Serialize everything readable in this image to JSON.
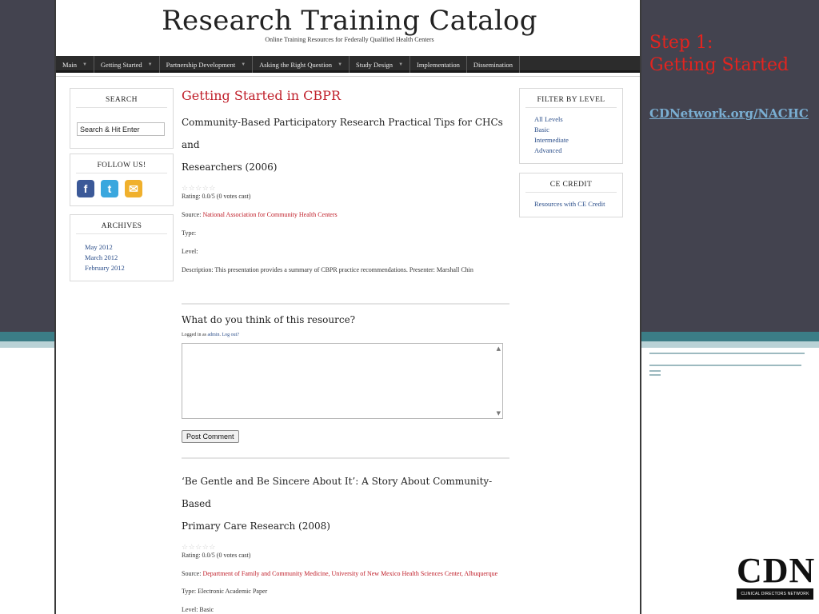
{
  "site": {
    "title": "Research Training Catalog",
    "subtitle": "Online Training Resources for Federally Qualified Health Centers"
  },
  "nav": [
    {
      "label": "Main",
      "dropdown": true
    },
    {
      "label": "Getting Started",
      "dropdown": true
    },
    {
      "label": "Partnership Development",
      "dropdown": true
    },
    {
      "label": "Asking the Right Question",
      "dropdown": true
    },
    {
      "label": "Study Design",
      "dropdown": true
    },
    {
      "label": "Implementation",
      "dropdown": false
    },
    {
      "label": "Dissemination",
      "dropdown": false
    }
  ],
  "sidebar": {
    "search": {
      "title": "SEARCH",
      "value": "Search & Hit Enter"
    },
    "follow": {
      "title": "FOLLOW US!",
      "icons": [
        "facebook-icon",
        "twitter-icon",
        "email-icon"
      ]
    },
    "archives": {
      "title": "ARCHIVES",
      "items": [
        "May 2012",
        "March 2012",
        "February 2012"
      ]
    }
  },
  "main": {
    "heading": "Getting Started in CBPR",
    "resources": [
      {
        "title_lines": [
          "Community-Based Participatory Research Practical Tips for CHCs and",
          "Researchers (2006)"
        ],
        "stars": "☆☆☆☆☆",
        "rating": "Rating: 0.0/5 (0 votes cast)",
        "source_label": "Source: ",
        "source": "National Association for Community Health Centers",
        "type": "Type:",
        "level": "Level:",
        "description": "Description: This presentation provides a summary of CBPR practice recommendations. Presenter: Marshall Chin"
      },
      {
        "title_lines": [
          "‘Be Gentle and Be Sincere About It’: A Story About Community-Based",
          "Primary Care Research (2008)"
        ],
        "stars": "☆☆☆☆☆",
        "rating": "Rating: 0.0/5 (0 votes cast)",
        "source_label": "Source: ",
        "source": "Department of Family and Community Medicine, University of New Mexico Health Sciences Center, Albuquerque",
        "type": "Type: Electronic Academic Paper",
        "level": "Level: Basic"
      }
    ],
    "comment": {
      "heading": "What do you think of this resource?",
      "logged_prefix": "Logged in as ",
      "user": "admin",
      "logout": "Log out?",
      "button": "Post Comment"
    }
  },
  "right_sidebar": {
    "filter": {
      "title": "FILTER BY LEVEL",
      "items": [
        "All Levels",
        "Basic",
        "Intermediate",
        "Advanced"
      ]
    },
    "ce": {
      "title": "CE CREDIT",
      "items": [
        "Resources with CE Credit"
      ]
    }
  },
  "slide": {
    "step_line1": "Step 1:",
    "step_line2": "Getting Started",
    "url": "CDNetwork.org/NACHC",
    "logo_text": "CDN",
    "logo_sub": "CLINICAL DIRECTORS NETWORK"
  },
  "colors": {
    "accent_red": "#c0202b",
    "link_blue": "#2b4e8a",
    "slide_dark": "#43434f",
    "teal": "#3b7d86"
  }
}
